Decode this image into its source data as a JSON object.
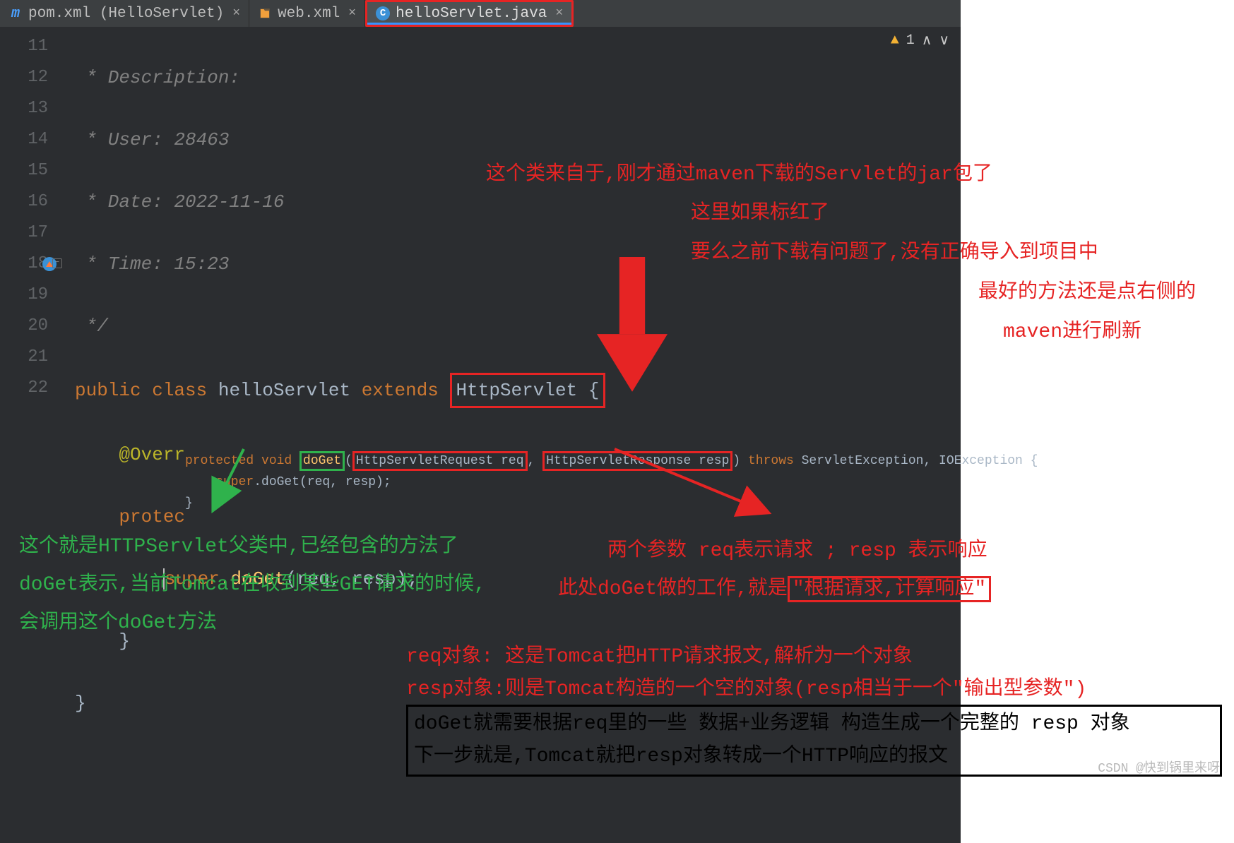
{
  "tabs": [
    {
      "label": "pom.xml (HelloServlet)",
      "icon": "maven",
      "active": false
    },
    {
      "label": "web.xml",
      "icon": "xml",
      "active": false
    },
    {
      "label": "helloServlet.java",
      "icon": "class",
      "active": true
    }
  ],
  "warning": {
    "count": "1"
  },
  "gutter": {
    "lines": [
      "11",
      "12",
      "13",
      "14",
      "15",
      "16",
      "17",
      "18",
      "19",
      "20",
      "21",
      "22"
    ]
  },
  "code": {
    "l11": " * Description:",
    "l12": " * User: 28463",
    "l13": " * Date: 2022-11-16",
    "l14": " * Time: 15:23",
    "l15": " */",
    "l16_public": "public ",
    "l16_class": "class ",
    "l16_name": "helloServlet ",
    "l16_extends": "extends ",
    "l16_super": "HttpServlet {",
    "l17": "    @Override",
    "l18_prot": "    protected ",
    "l18_void": "void ",
    "l18_meth": "doGet",
    "l18_rest": "(HttpServletRequest req, HttpServletResponse re",
    "l19_super": "        super",
    "l19_doget": ".doGet",
    "l19_rest": "(req, resp);",
    "l20": "    }",
    "l21": "}"
  },
  "signature": {
    "prot": "protected ",
    "void": "void ",
    "meth": "doGet",
    "open": "(",
    "p1": "HttpServletRequest req",
    "sep": ", ",
    "p2": "HttpServletResponse resp",
    "close": ") ",
    "throws": "throws ",
    "exc": "ServletException, IOException {",
    "body_super": "    super",
    "body_call": ".doGet(req, resp);",
    "end": "}"
  },
  "anno": {
    "top1": "这个类来自于,刚才通过maven下载的Servlet的jar包了",
    "top2": "这里如果标红了",
    "top3": "要么之前下载有问题了,没有正确导入到项目中",
    "top4_a": "最好的方法还是点右侧的",
    "top4_b": "maven进行刷新",
    "green1": "这个就是HTTPServlet父类中,已经包含的方法了",
    "green2": "doGet表示,当前Tomcat在收到某些GET请求的时候,",
    "green3": "会调用这个doGet方法",
    "mid1": "两个参数 req表示请求 ;  resp 表示响应",
    "mid2_a": "此处doGet做的工作,就是",
    "mid2_b": "\"根据请求,计算响应\"",
    "bot1": "req对象: 这是Tomcat把HTTP请求报文,解析为一个对象",
    "bot2": "resp对象:则是Tomcat构造的一个空的对象(resp相当于一个\"输出型参数\")",
    "box1": "doGet就需要根据req里的一些 数据+业务逻辑 构造生成一个完整的 resp 对象",
    "box2": "下一步就是,Tomcat就把resp对象转成一个HTTP响应的报文"
  },
  "watermark": "CSDN @快到锅里来呀"
}
